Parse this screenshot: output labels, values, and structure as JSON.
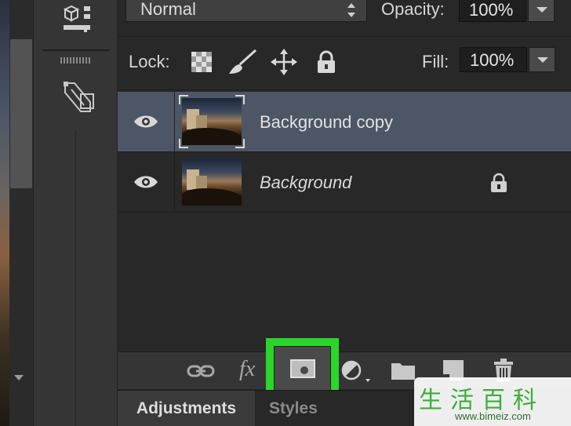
{
  "blend": {
    "mode": "Normal"
  },
  "opacity": {
    "label": "Opacity:",
    "value": "100%"
  },
  "lock": {
    "label": "Lock:"
  },
  "fill": {
    "label": "Fill:",
    "value": "100%"
  },
  "layers": [
    {
      "name": "Background copy",
      "visible": true,
      "selected": true,
      "locked": false
    },
    {
      "name": "Background",
      "visible": true,
      "selected": false,
      "locked": true
    }
  ],
  "bottom_toolbar": {
    "icons": [
      "link-layers-icon",
      "fx-icon",
      "add-mask-icon",
      "adjustment-layer-icon",
      "new-group-icon",
      "new-layer-icon",
      "trash-icon"
    ],
    "fx_label": "fx",
    "highlight_color": "#2ad62a"
  },
  "tabs": [
    {
      "label": "Adjustments",
      "active": true
    },
    {
      "label": "Styles",
      "active": false
    }
  ],
  "watermark": {
    "chars": "生活百科",
    "url": "www.bimeiz.com"
  },
  "colors": {
    "selected_row": "#4d5664",
    "panel_bg": "#282828"
  }
}
